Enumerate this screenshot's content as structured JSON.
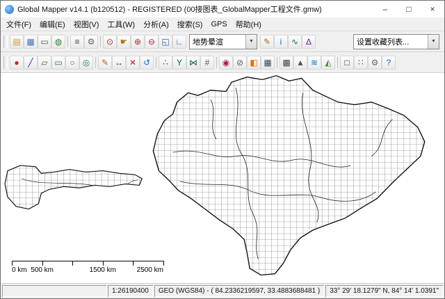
{
  "window": {
    "title": "Global Mapper v14.1 (b120512) - REGISTERED (00接图表_GlobalMapper工程文件.gmw)",
    "buttons": {
      "minimize": "–",
      "maximize": "□",
      "close": "×"
    }
  },
  "menu": {
    "items": [
      "文件(F)",
      "编辑(E)",
      "视图(V)",
      "工具(W)",
      "分析(A)",
      "搜索(S)",
      "GPS",
      "帮助(H)"
    ]
  },
  "icons": {
    "caret_down": "▼"
  },
  "toolbar1": {
    "shader_value": "地势晕渲",
    "favorites_value": "设置收藏列表...",
    "icons": [
      {
        "name": "open-file-icon",
        "glyph": "▤",
        "color": "#c79a2a"
      },
      {
        "name": "save-workspace-icon",
        "glyph": "▦",
        "color": "#3f6fb5"
      },
      {
        "name": "print-icon",
        "glyph": "▭",
        "color": "#555555"
      },
      {
        "name": "open-online-data-icon",
        "glyph": "◍",
        "color": "#2e7d32"
      },
      {
        "name": "separator",
        "sep": true
      },
      {
        "name": "overlay-control-center-icon",
        "glyph": "≡",
        "color": "#444444"
      },
      {
        "name": "configuration-icon",
        "glyph": "⚙",
        "color": "#666666"
      },
      {
        "name": "separator",
        "sep": true
      },
      {
        "name": "zoom-tool-icon",
        "glyph": "⊙",
        "color": "#a03030"
      },
      {
        "name": "pan-tool-icon",
        "glyph": "☛",
        "color": "#a67c00"
      },
      {
        "name": "zoom-in-icon",
        "glyph": "⊕",
        "color": "#a03030"
      },
      {
        "name": "zoom-out-icon",
        "glyph": "⊖",
        "color": "#a03030"
      },
      {
        "name": "full-view-icon",
        "glyph": "◱",
        "color": "#2a5fa5"
      },
      {
        "name": "measure-tool-icon",
        "glyph": "∟",
        "color": "#2a5fa5"
      }
    ],
    "icons2": [
      {
        "name": "digitizer-tool-icon",
        "glyph": "✎",
        "color": "#b5651d"
      },
      {
        "name": "feature-info-icon",
        "glyph": "i",
        "color": "#1565c0"
      },
      {
        "name": "path-profile-icon",
        "glyph": "∿",
        "color": "#00695c"
      },
      {
        "name": "3d-view-icon",
        "glyph": "∆",
        "color": "#6a1b9a"
      }
    ]
  },
  "toolbar2": {
    "icons": [
      {
        "name": "create-point-icon",
        "glyph": "●",
        "color": "#c62828"
      },
      {
        "name": "create-line-icon",
        "glyph": "╱",
        "color": "#283593"
      },
      {
        "name": "create-area-icon",
        "glyph": "▱",
        "color": "#2e7d32"
      },
      {
        "name": "create-rectangle-icon",
        "glyph": "▭",
        "color": "#2e7d32"
      },
      {
        "name": "create-circle-icon",
        "glyph": "○",
        "color": "#2e7d32"
      },
      {
        "name": "create-range-rings-icon",
        "glyph": "◎",
        "color": "#2e7d32"
      },
      {
        "name": "separator",
        "sep": true
      },
      {
        "name": "edit-feature-icon",
        "glyph": "✎",
        "color": "#b5651d"
      },
      {
        "name": "move-feature-icon",
        "glyph": "↔",
        "color": "#444444"
      },
      {
        "name": "delete-feature-icon",
        "glyph": "✕",
        "color": "#b71c1c"
      },
      {
        "name": "undo-icon",
        "glyph": "↺",
        "color": "#1565c0"
      },
      {
        "name": "separator",
        "sep": true
      },
      {
        "name": "vertex-edit-icon",
        "glyph": "∴",
        "color": "#4527a0"
      },
      {
        "name": "split-line-icon",
        "glyph": "Y",
        "color": "#00695c"
      },
      {
        "name": "combine-lines-icon",
        "glyph": "⋈",
        "color": "#00695c"
      },
      {
        "name": "snap-toggle-icon",
        "glyph": "#",
        "color": "#555555"
      },
      {
        "name": "separator",
        "sep": true
      },
      {
        "name": "buffer-icon",
        "glyph": "◉",
        "color": "#ad1457"
      },
      {
        "name": "crop-icon",
        "glyph": "⊘",
        "color": "#555555"
      },
      {
        "name": "paint-icon",
        "glyph": "◧",
        "color": "#ef6c00"
      },
      {
        "name": "attributes-icon",
        "glyph": "▦",
        "color": "#37474f"
      },
      {
        "name": "separator",
        "sep": true
      },
      {
        "name": "grid-create-icon",
        "glyph": "▩",
        "color": "#37474f"
      },
      {
        "name": "terrain-icon",
        "glyph": "▲",
        "color": "#6d4c41"
      },
      {
        "name": "watershed-icon",
        "glyph": "≋",
        "color": "#0277bd"
      },
      {
        "name": "viewshed-icon",
        "glyph": "◭",
        "color": "#558b2f"
      },
      {
        "name": "separator",
        "sep": true
      },
      {
        "name": "select-features-icon",
        "glyph": "□",
        "color": "#333333"
      },
      {
        "name": "lidar-icon",
        "glyph": "∷",
        "color": "#5e35b1"
      },
      {
        "name": "options-icon",
        "glyph": "⚙",
        "color": "#666666"
      },
      {
        "name": "help-icon",
        "glyph": "?",
        "color": "#1565c0"
      }
    ]
  },
  "scalebar": {
    "l0": "0 km",
    "l1": "500 km",
    "l2": "1500 km",
    "l3": "2500 km"
  },
  "statusbar": {
    "scale": "1:26190400",
    "projection": "GEO (WGS84) - ( 84.2336219597, 33.4883688481 )",
    "coords": "33° 29' 18.1279\" N, 84° 14' 1.0391\""
  },
  "colors": {
    "grid": "#4a4a4a",
    "outline": "#111111",
    "boundary": "#222222",
    "map_background": "#ffffff"
  }
}
